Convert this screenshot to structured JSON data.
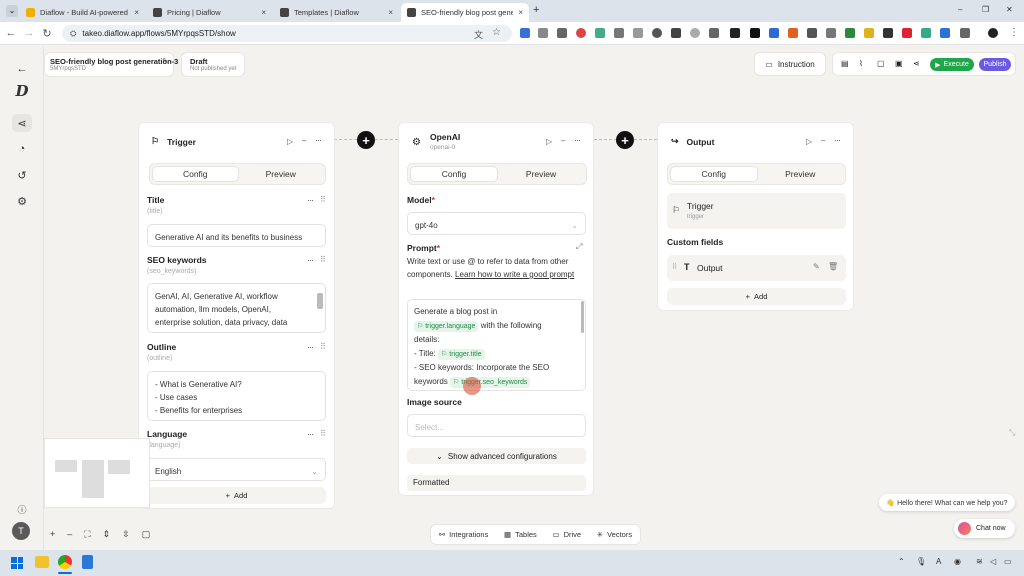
{
  "browser": {
    "tabs": [
      {
        "title": "Diaflow - Build AI-powered app",
        "color": "#f0b000",
        "close": "×"
      },
      {
        "title": "Pricing | Diaflow",
        "color": "#444",
        "close": "×"
      },
      {
        "title": "Templates | Diaflow",
        "color": "#444",
        "close": "×"
      },
      {
        "title": "SEO-friendly blog post generati",
        "color": "#444",
        "close": "×"
      }
    ],
    "new_tab": "+",
    "url": "takeo.diaflow.app/flows/5MYrpqsSTD/show",
    "window_controls": [
      "–",
      "❐",
      "✕"
    ]
  },
  "header": {
    "flow_title": "SEO-friendly blog post generation-3",
    "flow_id": "5MYrpqsSTD",
    "status": "Draft",
    "status_sub": "Not published yet",
    "instruction_label": "Instruction",
    "execute_label": "Execute",
    "publish_label": "Publish"
  },
  "trigger": {
    "title": "Trigger",
    "tabs": [
      "Config",
      "Preview"
    ],
    "fields": [
      {
        "label": "Title",
        "key": "(title)",
        "value": "Generative AI and its benefits to business"
      },
      {
        "label": "SEO keywords",
        "key": "(seo_keywords)",
        "value": "GenAI, AI, Generative AI, workflow automation, llm models, OpenAI, enterprise solution, data privacy, data security, Diaflow"
      },
      {
        "label": "Outline",
        "key": "(outline)",
        "value": "- What is Generative AI?\n- Use cases\n- Benefits for enterprises"
      },
      {
        "label": "Language",
        "key": "(language)",
        "value": "English"
      }
    ],
    "add_label": "Add"
  },
  "openai": {
    "title": "OpenAI",
    "sub": "openai-0",
    "tabs": [
      "Config",
      "Preview"
    ],
    "model_label": "Model",
    "required_mark": "*",
    "model_value": "gpt-4o",
    "prompt_label": "Prompt",
    "prompt_help": "Write text or use @ to refer to data from other components.",
    "prompt_link": "Learn how to write a good prompt",
    "prompt_text": {
      "l1": "Generate a blog post in",
      "chip1": "trigger.language",
      "l2": "with the following",
      "l3": "details:",
      "l4": "- Title:",
      "chip2": "trigger.title",
      "l5": "- SEO keywords: Incorporate the SEO",
      "l6": "keywords",
      "chip3": "trigger.seo_keywords"
    },
    "image_label": "Image source",
    "image_placeholder": "Select...",
    "advanced_label": "Show advanced configurations",
    "formatted_label": "Formatted"
  },
  "output": {
    "title": "Output",
    "tabs": [
      "Config",
      "Preview"
    ],
    "trigger_name": "Trigger",
    "trigger_sub": "trigger",
    "custom_fields_label": "Custom fields",
    "output_field": "Output",
    "add_label": "Add"
  },
  "bottom_toolbar": [
    "Integrations",
    "Tables",
    "Drive",
    "Vectors"
  ],
  "chat": {
    "bubble": "👋 Hello there! What can we help you?",
    "button": "Chat now"
  },
  "user_initial": "T"
}
